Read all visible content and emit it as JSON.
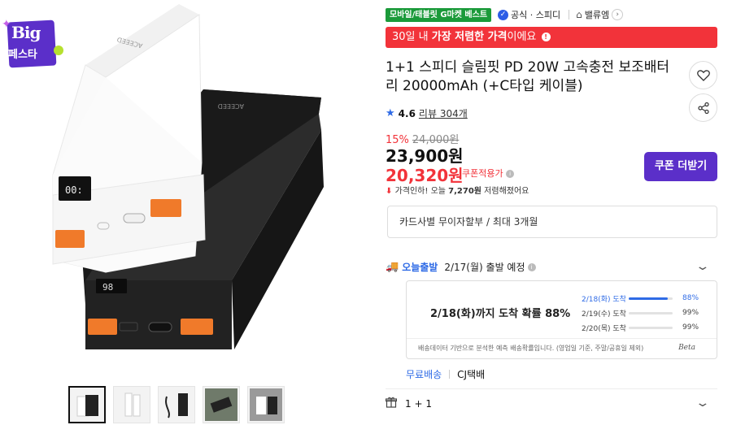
{
  "badge": {
    "line1": "Big",
    "line2": "페스타"
  },
  "tags": {
    "category": "모바일/태블릿 G마켓 베스트",
    "official": "공식 · 스피디",
    "store": "밸류엠"
  },
  "banner": {
    "prefix": "30일 내 ",
    "bold": "가장 저렴한 가격",
    "suffix": "이에요"
  },
  "product": {
    "title": "1+1 스피디 슬림핏 PD 20W 고속충전 보조배터리 20000mAh (+C타입 케이블)",
    "rating": "4.6",
    "review": "리뷰 304개"
  },
  "pricing": {
    "discount_pct": "15%",
    "original": "24,000원",
    "price": "23,900원",
    "coupon_price": "20,320원",
    "coupon_applied": "쿠폰적용가",
    "coupon_button": "쿠폰 더받기",
    "drop_prefix": "가격인하! 오늘 ",
    "drop_amount": "7,270원",
    "drop_suffix": " 저렴해졌어요"
  },
  "card_benefit": "카드사별 무이자할부 / 최대 3개월",
  "shipping": {
    "today_label": "오늘출발",
    "date_text": "2/17(월) 출발 예정",
    "probability_headline": "2/18(화)까지 도착 확률 88%",
    "rows": [
      {
        "label": "2/18(화) 도착",
        "pct": "88%",
        "fill": 0.88
      },
      {
        "label": "2/19(수) 도착",
        "pct": "99%",
        "fill": 0
      },
      {
        "label": "2/20(목) 도착",
        "pct": "99%",
        "fill": 0
      }
    ],
    "note": "배송데이터 기반으로 분석한 예측 배송확률입니다. (영업일 기준, 주말/공휴일 제외)",
    "beta": "Beta",
    "free": "무료배송",
    "carrier": "CJ택배"
  },
  "option": "1 + 1",
  "colors": {
    "accent_red": "#f2333a",
    "accent_purple": "#5b2fc9",
    "accent_blue": "#2f6be6",
    "tag_green": "#1b9a3a"
  }
}
